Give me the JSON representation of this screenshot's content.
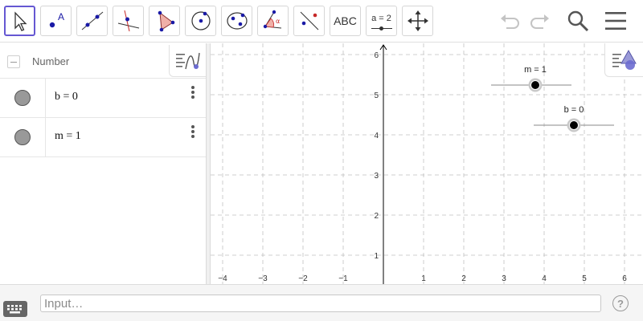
{
  "toolbar": {
    "tools": [
      {
        "name": "move-tool",
        "icon": "arrow-cursor-icon"
      },
      {
        "name": "point-tool",
        "icon": "point-icon"
      },
      {
        "name": "line-tool",
        "icon": "line-icon"
      },
      {
        "name": "perpendicular-line-tool",
        "icon": "perpendicular-icon"
      },
      {
        "name": "polygon-tool",
        "icon": "polygon-icon"
      },
      {
        "name": "circle-tool",
        "icon": "circle-icon"
      },
      {
        "name": "ellipse-tool",
        "icon": "ellipse-icon"
      },
      {
        "name": "angle-tool",
        "icon": "angle-icon"
      },
      {
        "name": "reflect-tool",
        "icon": "reflect-icon"
      },
      {
        "name": "text-tool",
        "label": "ABC"
      },
      {
        "name": "slider-tool",
        "label": "a = 2"
      },
      {
        "name": "move-graphics-view-tool",
        "icon": "move-arrows-icon"
      }
    ],
    "selected_tool": "move-tool"
  },
  "algebra": {
    "sort_label": "Number",
    "items": [
      {
        "text": "b = 0"
      },
      {
        "text": "m = 1"
      }
    ]
  },
  "graph": {
    "x_ticks": [
      "−4",
      "−3",
      "−2",
      "−1",
      "1",
      "2",
      "3",
      "4",
      "5",
      "6"
    ],
    "y_ticks": [
      "1",
      "2",
      "3",
      "4",
      "5",
      "6"
    ],
    "sliders": [
      {
        "label": "m = 1",
        "value": 1
      },
      {
        "label": "b = 0",
        "value": 0
      }
    ]
  },
  "input": {
    "placeholder": "Input…",
    "help": "?"
  },
  "colors": {
    "accent": "#6557d2",
    "grid": "#c0c0c0",
    "axis": "#000000"
  }
}
